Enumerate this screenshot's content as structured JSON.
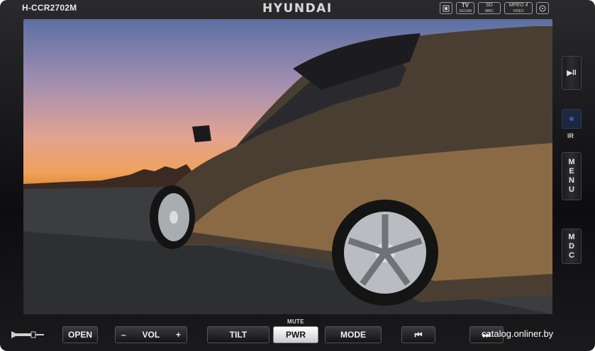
{
  "header": {
    "model": "H-CCR2702M",
    "brand": "HYUNDAI",
    "badges": [
      {
        "icon": "media-icon",
        "label": ""
      },
      {
        "icon": "tv-icon",
        "label": "TV",
        "sub": "SECAM"
      },
      {
        "icon": "sd-card-icon",
        "label": "SD",
        "sub": "MMC"
      },
      {
        "icon": "mpeg4-icon",
        "label": "MPEG 4",
        "sub": "VIDEO"
      },
      {
        "icon": "disc-icon",
        "label": ""
      }
    ]
  },
  "side_buttons": {
    "play_pause": "▶ll",
    "ir_label": "IR",
    "menu": "MENU",
    "mdc": "MDC"
  },
  "bottom": {
    "mute_label": "MUTE",
    "open": "OPEN",
    "vol_minus": "–",
    "vol_label": "VOL",
    "vol_plus": "+",
    "tilt": "TILT",
    "pwr": "PWR",
    "mode": "MODE",
    "prev": "⏮",
    "next": "⏭",
    "aux_icon": "aux-jack-icon"
  },
  "watermark": "catalog.onliner.by",
  "colors": {
    "body": "#0d0d0f",
    "power_button": "#ffffff"
  }
}
